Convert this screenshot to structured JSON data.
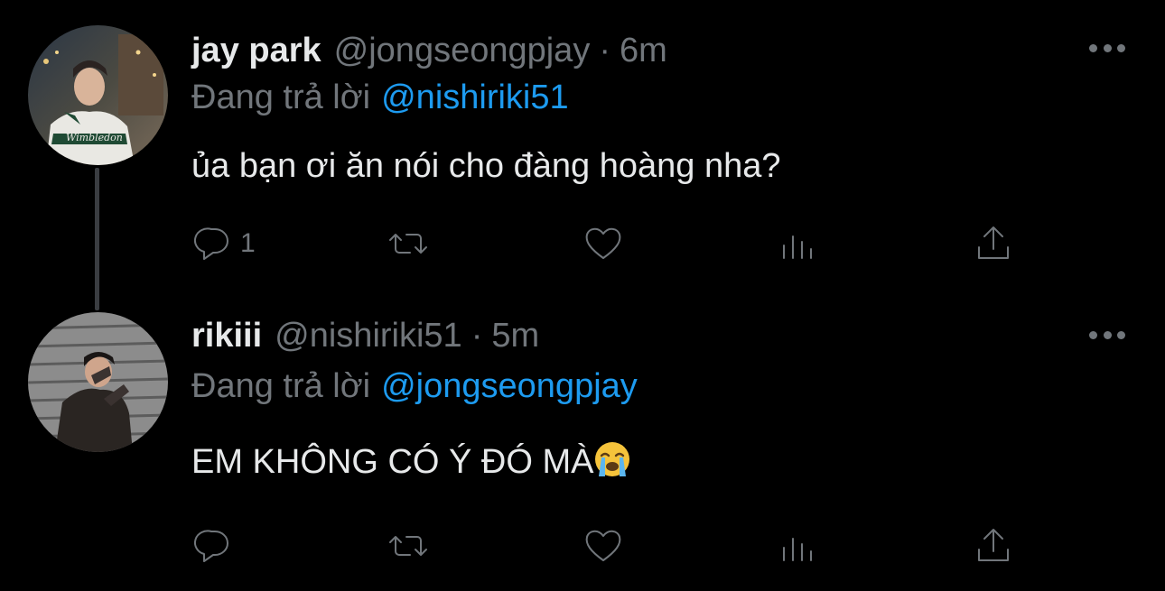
{
  "tweets": [
    {
      "display_name": "jay park",
      "handle": "@jongseongpjay",
      "separator": "·",
      "time": "6m",
      "replying_prefix": "Đang trả lời",
      "replying_to": "@nishiriki51",
      "text": "ủa bạn ơi ăn nói cho đàng hoàng nha?",
      "reply_count": "1",
      "avatar_icon": "avatar-photo"
    },
    {
      "display_name": "rikiii",
      "handle": "@nishiriki51",
      "separator": "·",
      "time": "5m",
      "replying_prefix": "Đang trả lời",
      "replying_to": "@jongseongpjay",
      "text": "EM KHÔNG CÓ Ý ĐÓ MÀ",
      "text_emoji": "loudly-crying-face",
      "reply_count": "",
      "avatar_icon": "avatar-photo"
    }
  ],
  "colors": {
    "background": "#000000",
    "text_primary": "#e7e9ea",
    "text_secondary": "#71767b",
    "link": "#1d9bf0"
  },
  "icons": [
    "reply-icon",
    "retweet-icon",
    "like-icon",
    "views-icon",
    "share-icon",
    "more-icon"
  ]
}
